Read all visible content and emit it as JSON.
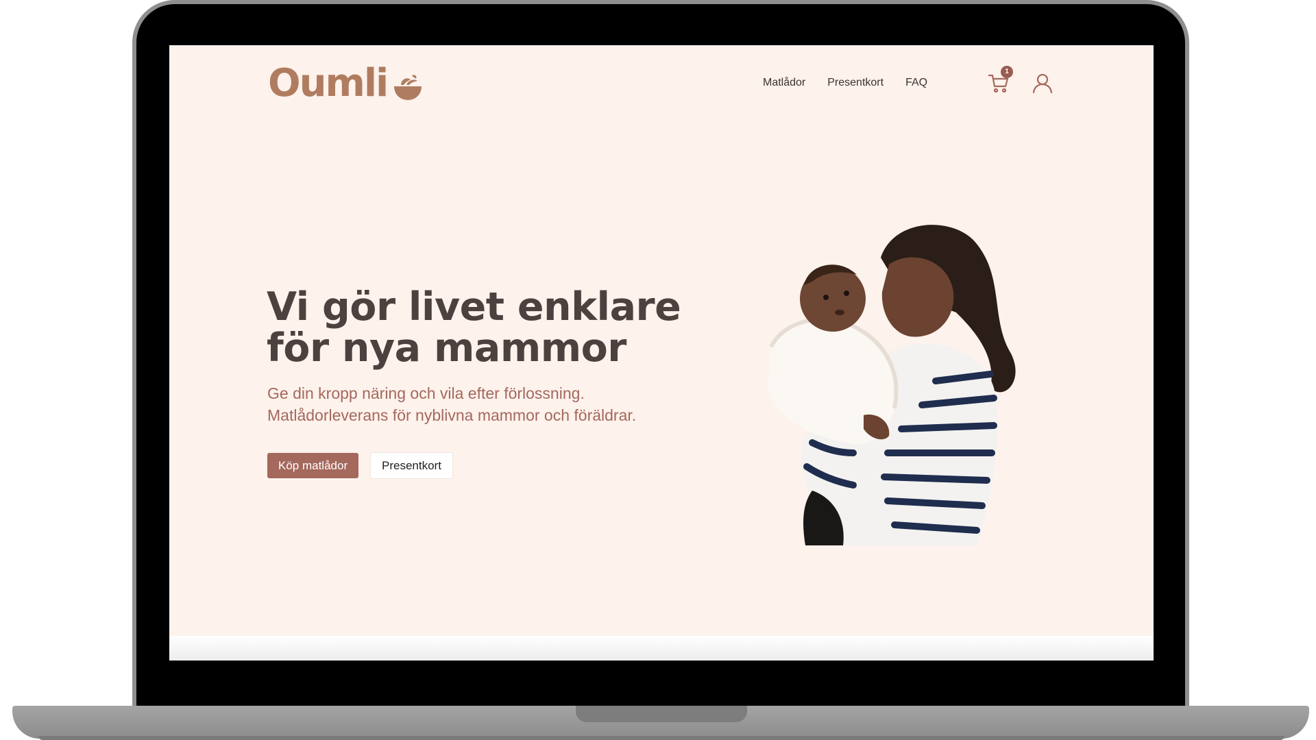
{
  "brand": {
    "logo_text": "Oumli",
    "logo_color": "#b07c60"
  },
  "nav": {
    "items": [
      {
        "label": "Matlådor"
      },
      {
        "label": "Presentkort"
      },
      {
        "label": "FAQ"
      }
    ],
    "cart_count": "1",
    "cart_icon": "shopping-cart-icon",
    "user_icon": "user-icon"
  },
  "hero": {
    "title_line1": "Vi gör livet enklare",
    "title_line2": "för nya mammor",
    "subtitle_line1": "Ge din kropp näring och vila efter förlossning.",
    "subtitle_line2": "Matlådorleverans för nyblivna mammor och föräldrar.",
    "primary_button": "Köp matlådor",
    "secondary_button": "Presentkort"
  },
  "colors": {
    "background": "#fdf2ec",
    "accent": "#a4685c",
    "heading": "#4d413f"
  }
}
